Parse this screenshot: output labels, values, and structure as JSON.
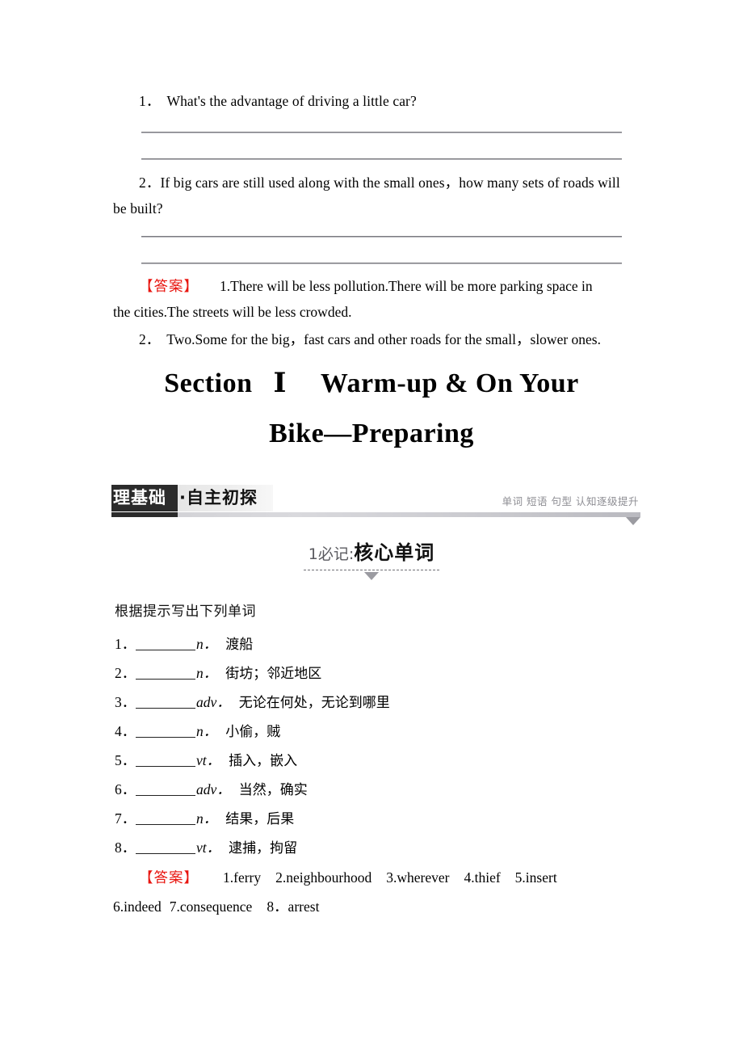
{
  "questions": [
    {
      "number": "1．",
      "text": "What's the advantage of driving a little car?"
    },
    {
      "number": "2．",
      "text": "If big cars are still used along with the small ones，how many sets of roads will",
      "continuation": "be built?"
    }
  ],
  "answer_tag": "【答案】",
  "answers_reading": {
    "line1_num": "1.",
    "line1": "There will be less pollution.There will be more parking space in",
    "line2": "the cities.The streets will be less crowded.",
    "line3_num": "2．",
    "line3": "Two.Some for the big，fast cars and other roads for the small，slower ones."
  },
  "section_title": {
    "label": "Section",
    "numeral": "Ⅰ",
    "line1": "Warm-up & On Your",
    "line2": "Bike—Preparing"
  },
  "banner": {
    "label_dark": "理基础",
    "label_light": "·自主初探",
    "right_text": "单词 短语 句型 认知逐级提升",
    "dark_color": "#2b2b2b",
    "bar_color": "#c8c8cd",
    "right_text_color": "#8d8d93"
  },
  "subheading": {
    "index": "1",
    "small": "必记:",
    "big": "核心单词"
  },
  "vocab": {
    "intro": "根据提示写出下列单词",
    "items": [
      {
        "number": "1．",
        "pos": "n．",
        "meaning": "渡船"
      },
      {
        "number": "2．",
        "pos": "n．",
        "meaning": "街坊；邻近地区"
      },
      {
        "number": "3．",
        "pos": "adv．",
        "meaning": "无论在何处，无论到哪里"
      },
      {
        "number": "4．",
        "pos": "n．",
        "meaning": "小偷，贼"
      },
      {
        "number": "5．",
        "pos": "vt．",
        "meaning": "插入，嵌入"
      },
      {
        "number": "6．",
        "pos": "adv．",
        "meaning": "当然，确实"
      },
      {
        "number": "7．",
        "pos": "n．",
        "meaning": "结果，后果"
      },
      {
        "number": "8．",
        "pos": "vt．",
        "meaning": "逮捕，拘留"
      }
    ]
  },
  "vocab_answers": {
    "tag": "【答案】",
    "row1": [
      "1.ferry",
      "2.neighbourhood",
      "3.wherever",
      "4.thief",
      "5.insert"
    ],
    "row2": [
      "6.indeed",
      "7.consequence",
      "8．arrest"
    ]
  }
}
